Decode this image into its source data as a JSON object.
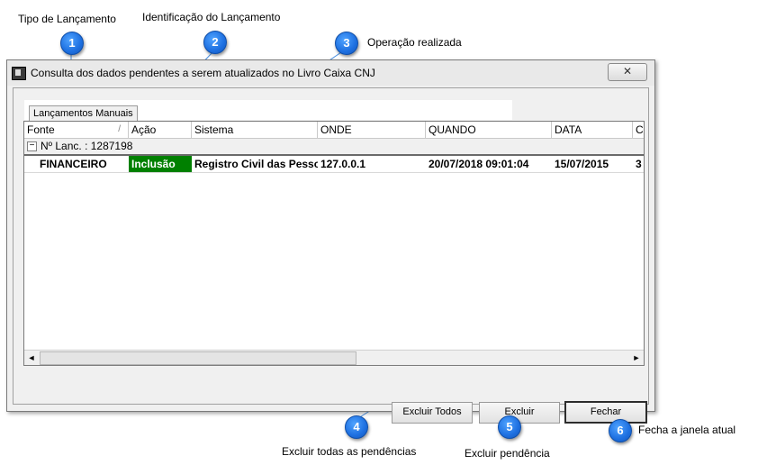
{
  "callouts": [
    {
      "num": "1",
      "label": "Tipo de Lançamento"
    },
    {
      "num": "2",
      "label": "Identificação do Lançamento"
    },
    {
      "num": "3",
      "label": "Operação realizada"
    },
    {
      "num": "4",
      "label": "Excluir todas as pendências"
    },
    {
      "num": "5",
      "label": "Excluir pendência"
    },
    {
      "num": "6",
      "label": "Fecha a janela atual"
    }
  ],
  "window": {
    "title": "Consulta dos dados pendentes a serem atualizados no Livro Caixa CNJ",
    "close_label": "✕"
  },
  "tabs": [
    "Lançamentos Manuais"
  ],
  "grid": {
    "columns": [
      "Fonte",
      "Ação",
      "Sistema",
      "ONDE",
      "QUANDO",
      "DATA",
      "C"
    ],
    "sort_indicator": "/",
    "group_label": "Nº Lanc. : 1287198",
    "group_toggle": "−",
    "rows": [
      [
        "FINANCEIRO",
        "Inclusão",
        "Registro Civil das Pesso",
        "127.0.0.1",
        "20/07/2018 09:01:04",
        "15/07/2015",
        "3"
      ]
    ],
    "scroll_left": "◄",
    "scroll_right": "►"
  },
  "buttons": {
    "excluir_todos": "Excluir Todos",
    "excluir": "Excluir",
    "fechar": "Fechar"
  },
  "colors": {
    "accent_action": "#008000",
    "badge": "#1d6fe0"
  }
}
